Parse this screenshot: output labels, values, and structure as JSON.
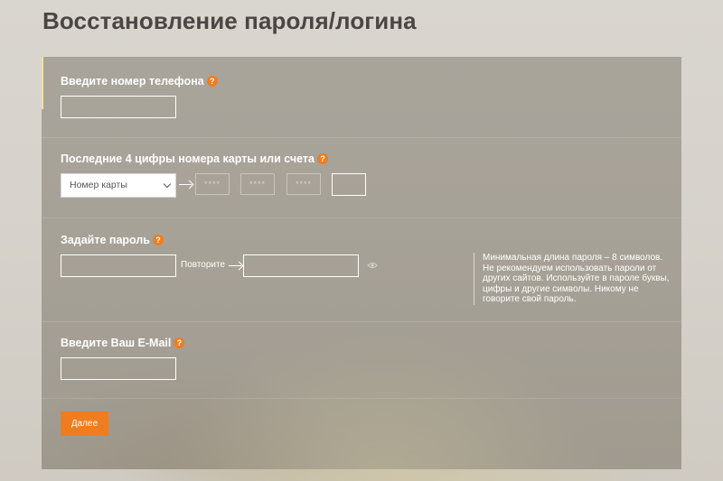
{
  "page": {
    "title": "Восстановление пароля/логина"
  },
  "phone_section": {
    "label": "Введите номер телефона",
    "help_icon": "?",
    "input_value": ""
  },
  "card_section": {
    "label": "Последние 4 цифры номера карты или счета",
    "help_icon": "?",
    "select_value": "Номер карты",
    "masked_groups": [
      "****",
      "****",
      "****"
    ],
    "last_digits_value": ""
  },
  "password_section": {
    "label": "Задайте пароль",
    "help_icon": "?",
    "password_value": "",
    "repeat_label": "Повторите",
    "repeat_value": "",
    "hint": "Минимальная длина пароля – 8 символов. Не рекомендуем использовать пароли от других сайтов. Используйте в пароле буквы, цифры и другие символы. Никому не говорите свой пароль."
  },
  "email_section": {
    "label": "Введите Ваш E-Mail",
    "help_icon": "?",
    "input_value": ""
  },
  "actions": {
    "next_label": "Далее"
  },
  "icons": {
    "help": "question-circle-icon",
    "arrow": "arrow-right-icon",
    "show_password": "eye-icon",
    "select": "chevron-down-icon"
  },
  "colors": {
    "accent": "#ef7d1f",
    "panel": "#a7a298",
    "title": "#494644",
    "active_marker": "#f2e2a2"
  }
}
